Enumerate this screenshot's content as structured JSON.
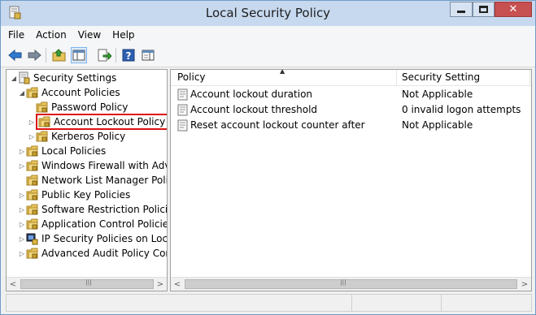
{
  "window": {
    "title": "Local Security Policy",
    "close_glyph": "✕"
  },
  "menu": [
    "File",
    "Action",
    "View",
    "Help"
  ],
  "toolbar": {
    "buttons": [
      "back-arrow-icon",
      "forward-arrow-icon",
      "up-folder-icon",
      "show-hide-tree-icon",
      "export-list-icon",
      "help-icon",
      "properties-pane-icon"
    ]
  },
  "tree": {
    "items": [
      {
        "label": "Security Settings",
        "icon": "security-settings-icon",
        "expander": "◢"
      },
      {
        "label": "Account Policies",
        "icon": "folder-icon",
        "expander": "◢"
      },
      {
        "label": "Password Policy",
        "icon": "folder-icon",
        "expander": ""
      },
      {
        "label": "Account Lockout Policy",
        "icon": "folder-icon",
        "expander": "▷"
      },
      {
        "label": "Kerberos Policy",
        "icon": "folder-icon",
        "expander": "▷"
      },
      {
        "label": "Local Policies",
        "icon": "folder-icon",
        "expander": "▷"
      },
      {
        "label": "Windows Firewall with Advar",
        "icon": "folder-icon",
        "expander": "▷"
      },
      {
        "label": "Network List Manager Policie",
        "icon": "folder-icon",
        "expander": ""
      },
      {
        "label": "Public Key Policies",
        "icon": "folder-icon",
        "expander": "▷"
      },
      {
        "label": "Software Restriction Policies",
        "icon": "folder-icon",
        "expander": "▷"
      },
      {
        "label": "Application Control Policies",
        "icon": "folder-icon",
        "expander": "▷"
      },
      {
        "label": "IP Security Policies on Local C",
        "icon": "ip-security-icon",
        "expander": "▷"
      },
      {
        "label": "Advanced Audit Policy Confi",
        "icon": "folder-icon",
        "expander": "▷"
      }
    ]
  },
  "list": {
    "columns": [
      "Policy",
      "Security Setting"
    ],
    "sort_indicator": "▲",
    "rows": [
      {
        "policy": "Account lockout duration",
        "setting": "Not Applicable"
      },
      {
        "policy": "Account lockout threshold",
        "setting": "0 invalid logon attempts"
      },
      {
        "policy": "Reset account lockout counter after",
        "setting": "Not Applicable"
      }
    ]
  },
  "scroll": {
    "left_arrow": "<",
    "right_arrow": ">",
    "thumb_grip": "|||"
  },
  "colors": {
    "titlebar": "#c7d9ef",
    "close_button": "#c75050",
    "selection_outline": "#dd1111",
    "folder": "#e8c35a"
  }
}
